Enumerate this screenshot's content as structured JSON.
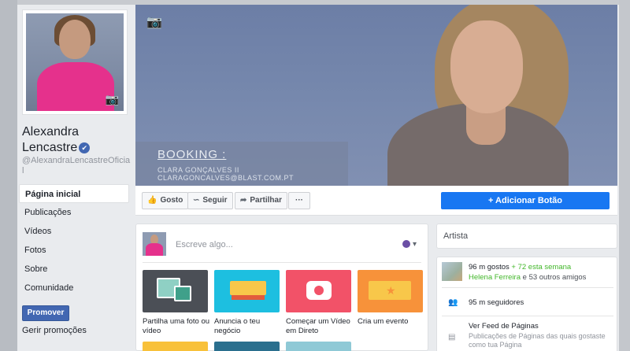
{
  "profile": {
    "name_line1": "Alexandra",
    "name_line2": "Lencastre",
    "verified_icon": "✔",
    "handle": "@AlexandraLencastreOficial"
  },
  "nav": {
    "items": [
      {
        "label": "Página inicial",
        "active": true
      },
      {
        "label": "Publicações"
      },
      {
        "label": "Vídeos"
      },
      {
        "label": "Fotos"
      },
      {
        "label": "Sobre"
      },
      {
        "label": "Comunidade"
      }
    ],
    "promote_label": "Promover",
    "manage_promotions_label": "Gerir promoções"
  },
  "cover": {
    "booking_title": "BOOKING :",
    "booking_contact": "CLARA GONÇALVES  II  CLARAGONCALVES@BLAST.COM.PT"
  },
  "actions": {
    "like_label": "Gosto",
    "follow_label": "Seguir",
    "share_label": "Partilhar",
    "more_label": "···",
    "add_button_label": "+ Adicionar Botão"
  },
  "composer": {
    "placeholder": "Escreve algo...",
    "tiles": [
      {
        "label": "Partilha uma foto ou vídeo",
        "color": "#4b4f56"
      },
      {
        "label": "Anuncia o teu negócio",
        "color": "#1dbfe0"
      },
      {
        "label": "Começar um Vídeo em Direto",
        "color": "#f25268"
      },
      {
        "label": "Cria um evento",
        "color": "#f7923a"
      }
    ]
  },
  "sidebar": {
    "category": "Artista",
    "likes_count": "96 m gostos",
    "likes_increase": "+ 72 esta semana",
    "friend_name": "Helena Ferreira",
    "friends_rest": "e 53 outros amigos",
    "followers": "95 m seguidores",
    "feed_title": "Ver Feed de Páginas",
    "feed_sub": "Publicações de Páginas das quais gostaste como tua Página"
  }
}
